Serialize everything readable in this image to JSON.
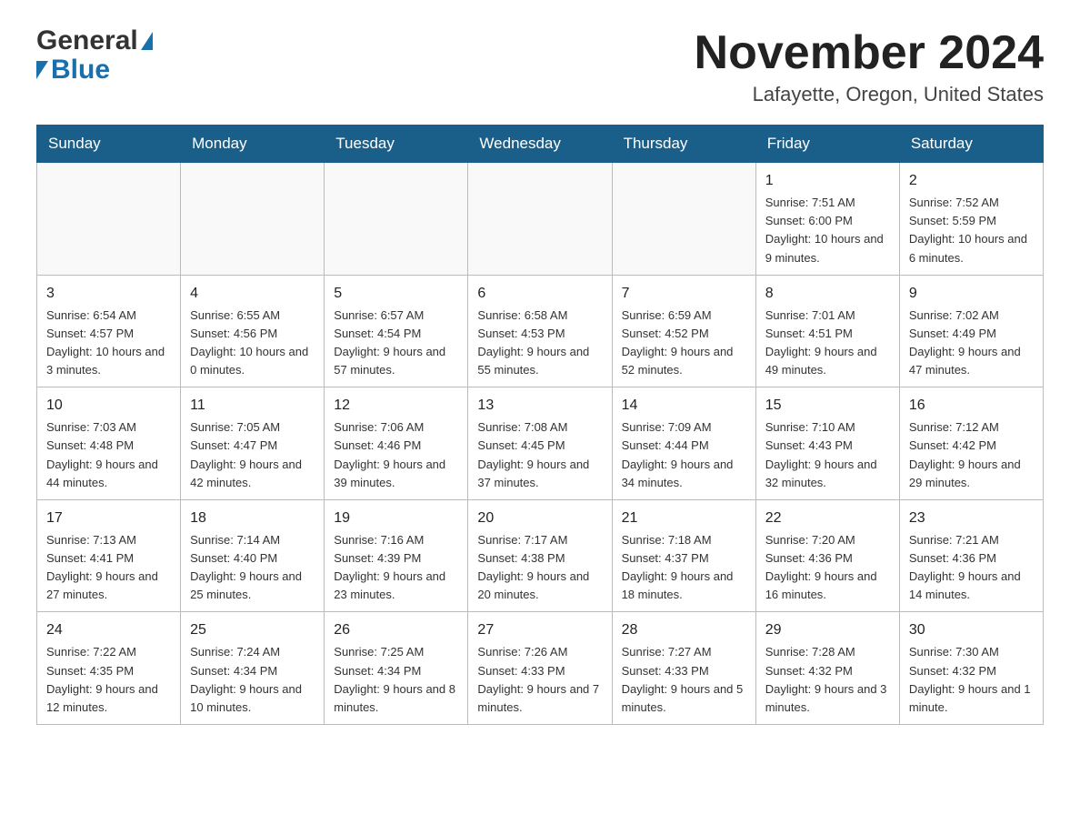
{
  "header": {
    "logo_general": "General",
    "logo_blue": "Blue",
    "title": "November 2024",
    "subtitle": "Lafayette, Oregon, United States"
  },
  "weekdays": [
    "Sunday",
    "Monday",
    "Tuesday",
    "Wednesday",
    "Thursday",
    "Friday",
    "Saturday"
  ],
  "rows": [
    [
      {
        "day": "",
        "info": ""
      },
      {
        "day": "",
        "info": ""
      },
      {
        "day": "",
        "info": ""
      },
      {
        "day": "",
        "info": ""
      },
      {
        "day": "",
        "info": ""
      },
      {
        "day": "1",
        "info": "Sunrise: 7:51 AM\nSunset: 6:00 PM\nDaylight: 10 hours and 9 minutes."
      },
      {
        "day": "2",
        "info": "Sunrise: 7:52 AM\nSunset: 5:59 PM\nDaylight: 10 hours and 6 minutes."
      }
    ],
    [
      {
        "day": "3",
        "info": "Sunrise: 6:54 AM\nSunset: 4:57 PM\nDaylight: 10 hours and 3 minutes."
      },
      {
        "day": "4",
        "info": "Sunrise: 6:55 AM\nSunset: 4:56 PM\nDaylight: 10 hours and 0 minutes."
      },
      {
        "day": "5",
        "info": "Sunrise: 6:57 AM\nSunset: 4:54 PM\nDaylight: 9 hours and 57 minutes."
      },
      {
        "day": "6",
        "info": "Sunrise: 6:58 AM\nSunset: 4:53 PM\nDaylight: 9 hours and 55 minutes."
      },
      {
        "day": "7",
        "info": "Sunrise: 6:59 AM\nSunset: 4:52 PM\nDaylight: 9 hours and 52 minutes."
      },
      {
        "day": "8",
        "info": "Sunrise: 7:01 AM\nSunset: 4:51 PM\nDaylight: 9 hours and 49 minutes."
      },
      {
        "day": "9",
        "info": "Sunrise: 7:02 AM\nSunset: 4:49 PM\nDaylight: 9 hours and 47 minutes."
      }
    ],
    [
      {
        "day": "10",
        "info": "Sunrise: 7:03 AM\nSunset: 4:48 PM\nDaylight: 9 hours and 44 minutes."
      },
      {
        "day": "11",
        "info": "Sunrise: 7:05 AM\nSunset: 4:47 PM\nDaylight: 9 hours and 42 minutes."
      },
      {
        "day": "12",
        "info": "Sunrise: 7:06 AM\nSunset: 4:46 PM\nDaylight: 9 hours and 39 minutes."
      },
      {
        "day": "13",
        "info": "Sunrise: 7:08 AM\nSunset: 4:45 PM\nDaylight: 9 hours and 37 minutes."
      },
      {
        "day": "14",
        "info": "Sunrise: 7:09 AM\nSunset: 4:44 PM\nDaylight: 9 hours and 34 minutes."
      },
      {
        "day": "15",
        "info": "Sunrise: 7:10 AM\nSunset: 4:43 PM\nDaylight: 9 hours and 32 minutes."
      },
      {
        "day": "16",
        "info": "Sunrise: 7:12 AM\nSunset: 4:42 PM\nDaylight: 9 hours and 29 minutes."
      }
    ],
    [
      {
        "day": "17",
        "info": "Sunrise: 7:13 AM\nSunset: 4:41 PM\nDaylight: 9 hours and 27 minutes."
      },
      {
        "day": "18",
        "info": "Sunrise: 7:14 AM\nSunset: 4:40 PM\nDaylight: 9 hours and 25 minutes."
      },
      {
        "day": "19",
        "info": "Sunrise: 7:16 AM\nSunset: 4:39 PM\nDaylight: 9 hours and 23 minutes."
      },
      {
        "day": "20",
        "info": "Sunrise: 7:17 AM\nSunset: 4:38 PM\nDaylight: 9 hours and 20 minutes."
      },
      {
        "day": "21",
        "info": "Sunrise: 7:18 AM\nSunset: 4:37 PM\nDaylight: 9 hours and 18 minutes."
      },
      {
        "day": "22",
        "info": "Sunrise: 7:20 AM\nSunset: 4:36 PM\nDaylight: 9 hours and 16 minutes."
      },
      {
        "day": "23",
        "info": "Sunrise: 7:21 AM\nSunset: 4:36 PM\nDaylight: 9 hours and 14 minutes."
      }
    ],
    [
      {
        "day": "24",
        "info": "Sunrise: 7:22 AM\nSunset: 4:35 PM\nDaylight: 9 hours and 12 minutes."
      },
      {
        "day": "25",
        "info": "Sunrise: 7:24 AM\nSunset: 4:34 PM\nDaylight: 9 hours and 10 minutes."
      },
      {
        "day": "26",
        "info": "Sunrise: 7:25 AM\nSunset: 4:34 PM\nDaylight: 9 hours and 8 minutes."
      },
      {
        "day": "27",
        "info": "Sunrise: 7:26 AM\nSunset: 4:33 PM\nDaylight: 9 hours and 7 minutes."
      },
      {
        "day": "28",
        "info": "Sunrise: 7:27 AM\nSunset: 4:33 PM\nDaylight: 9 hours and 5 minutes."
      },
      {
        "day": "29",
        "info": "Sunrise: 7:28 AM\nSunset: 4:32 PM\nDaylight: 9 hours and 3 minutes."
      },
      {
        "day": "30",
        "info": "Sunrise: 7:30 AM\nSunset: 4:32 PM\nDaylight: 9 hours and 1 minute."
      }
    ]
  ]
}
